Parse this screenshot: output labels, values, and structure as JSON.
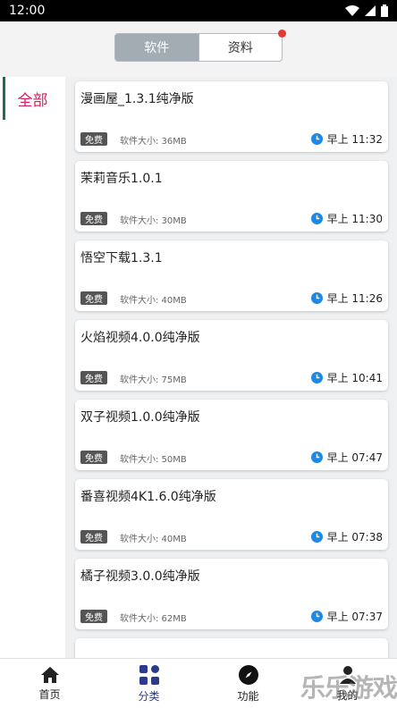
{
  "status": {
    "time": "12:00"
  },
  "header": {
    "tabs": [
      {
        "label": "软件",
        "active": true
      },
      {
        "label": "资料",
        "active": false
      }
    ]
  },
  "sidebar": {
    "items": [
      {
        "label": "全部",
        "active": true
      }
    ]
  },
  "list": {
    "items": [
      {
        "title": "漫画屋_1.3.1纯净版",
        "badge": "免费",
        "size": "软件大小: 36MB",
        "time": "早上 11:32"
      },
      {
        "title": "茉莉音乐1.0.1",
        "badge": "免费",
        "size": "软件大小: 30MB",
        "time": "早上 11:30"
      },
      {
        "title": "悟空下载1.3.1",
        "badge": "免费",
        "size": "软件大小: 40MB",
        "time": "早上 11:26"
      },
      {
        "title": "火焰视频4.0.0纯净版",
        "badge": "免费",
        "size": "软件大小: 75MB",
        "time": "早上 10:41"
      },
      {
        "title": "双子视频1.0.0纯净版",
        "badge": "免费",
        "size": "软件大小: 50MB",
        "time": "早上 07:47"
      },
      {
        "title": "番喜视频4K1.6.0纯净版",
        "badge": "免费",
        "size": "软件大小: 40MB",
        "time": "早上 07:38"
      },
      {
        "title": "橘子视频3.0.0纯净版",
        "badge": "免费",
        "size": "软件大小: 62MB",
        "time": "早上 07:37"
      }
    ]
  },
  "tabbar": {
    "items": [
      {
        "label": "首页",
        "icon": "home-icon"
      },
      {
        "label": "分类",
        "icon": "grid-icon",
        "active": true
      },
      {
        "label": "功能",
        "icon": "compass-icon"
      },
      {
        "label": "我的",
        "icon": "user-icon"
      }
    ]
  },
  "watermark": {
    "text": "乐乐游戏"
  },
  "colors": {
    "accent": "#d81b60",
    "sidebar_bar": "#1e6b5c",
    "clock": "#1e88e5",
    "tab_active": "#2a3a8f"
  }
}
